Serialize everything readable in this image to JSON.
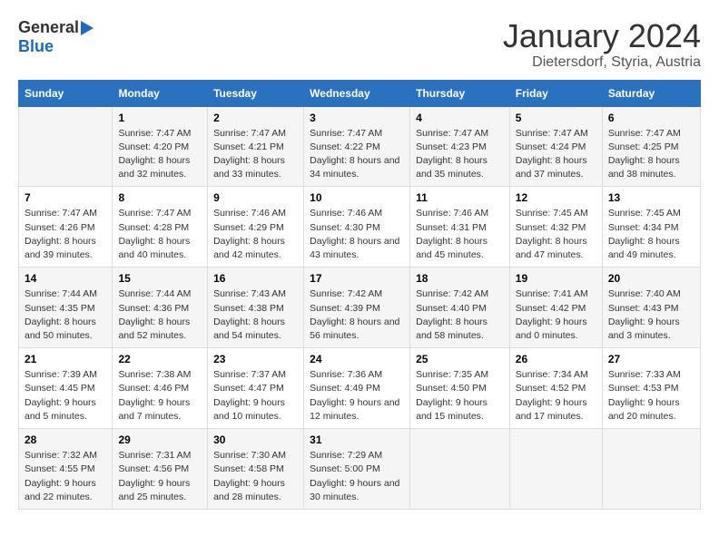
{
  "header": {
    "logo_general": "General",
    "logo_blue": "Blue",
    "month_year": "January 2024",
    "location": "Dietersdorf, Styria, Austria"
  },
  "days_of_week": [
    "Sunday",
    "Monday",
    "Tuesday",
    "Wednesday",
    "Thursday",
    "Friday",
    "Saturday"
  ],
  "weeks": [
    [
      {
        "day": "",
        "sunrise": "",
        "sunset": "",
        "daylight": ""
      },
      {
        "day": "1",
        "sunrise": "Sunrise: 7:47 AM",
        "sunset": "Sunset: 4:20 PM",
        "daylight": "Daylight: 8 hours and 32 minutes."
      },
      {
        "day": "2",
        "sunrise": "Sunrise: 7:47 AM",
        "sunset": "Sunset: 4:21 PM",
        "daylight": "Daylight: 8 hours and 33 minutes."
      },
      {
        "day": "3",
        "sunrise": "Sunrise: 7:47 AM",
        "sunset": "Sunset: 4:22 PM",
        "daylight": "Daylight: 8 hours and 34 minutes."
      },
      {
        "day": "4",
        "sunrise": "Sunrise: 7:47 AM",
        "sunset": "Sunset: 4:23 PM",
        "daylight": "Daylight: 8 hours and 35 minutes."
      },
      {
        "day": "5",
        "sunrise": "Sunrise: 7:47 AM",
        "sunset": "Sunset: 4:24 PM",
        "daylight": "Daylight: 8 hours and 37 minutes."
      },
      {
        "day": "6",
        "sunrise": "Sunrise: 7:47 AM",
        "sunset": "Sunset: 4:25 PM",
        "daylight": "Daylight: 8 hours and 38 minutes."
      }
    ],
    [
      {
        "day": "7",
        "sunrise": "Sunrise: 7:47 AM",
        "sunset": "Sunset: 4:26 PM",
        "daylight": "Daylight: 8 hours and 39 minutes."
      },
      {
        "day": "8",
        "sunrise": "Sunrise: 7:47 AM",
        "sunset": "Sunset: 4:28 PM",
        "daylight": "Daylight: 8 hours and 40 minutes."
      },
      {
        "day": "9",
        "sunrise": "Sunrise: 7:46 AM",
        "sunset": "Sunset: 4:29 PM",
        "daylight": "Daylight: 8 hours and 42 minutes."
      },
      {
        "day": "10",
        "sunrise": "Sunrise: 7:46 AM",
        "sunset": "Sunset: 4:30 PM",
        "daylight": "Daylight: 8 hours and 43 minutes."
      },
      {
        "day": "11",
        "sunrise": "Sunrise: 7:46 AM",
        "sunset": "Sunset: 4:31 PM",
        "daylight": "Daylight: 8 hours and 45 minutes."
      },
      {
        "day": "12",
        "sunrise": "Sunrise: 7:45 AM",
        "sunset": "Sunset: 4:32 PM",
        "daylight": "Daylight: 8 hours and 47 minutes."
      },
      {
        "day": "13",
        "sunrise": "Sunrise: 7:45 AM",
        "sunset": "Sunset: 4:34 PM",
        "daylight": "Daylight: 8 hours and 49 minutes."
      }
    ],
    [
      {
        "day": "14",
        "sunrise": "Sunrise: 7:44 AM",
        "sunset": "Sunset: 4:35 PM",
        "daylight": "Daylight: 8 hours and 50 minutes."
      },
      {
        "day": "15",
        "sunrise": "Sunrise: 7:44 AM",
        "sunset": "Sunset: 4:36 PM",
        "daylight": "Daylight: 8 hours and 52 minutes."
      },
      {
        "day": "16",
        "sunrise": "Sunrise: 7:43 AM",
        "sunset": "Sunset: 4:38 PM",
        "daylight": "Daylight: 8 hours and 54 minutes."
      },
      {
        "day": "17",
        "sunrise": "Sunrise: 7:42 AM",
        "sunset": "Sunset: 4:39 PM",
        "daylight": "Daylight: 8 hours and 56 minutes."
      },
      {
        "day": "18",
        "sunrise": "Sunrise: 7:42 AM",
        "sunset": "Sunset: 4:40 PM",
        "daylight": "Daylight: 8 hours and 58 minutes."
      },
      {
        "day": "19",
        "sunrise": "Sunrise: 7:41 AM",
        "sunset": "Sunset: 4:42 PM",
        "daylight": "Daylight: 9 hours and 0 minutes."
      },
      {
        "day": "20",
        "sunrise": "Sunrise: 7:40 AM",
        "sunset": "Sunset: 4:43 PM",
        "daylight": "Daylight: 9 hours and 3 minutes."
      }
    ],
    [
      {
        "day": "21",
        "sunrise": "Sunrise: 7:39 AM",
        "sunset": "Sunset: 4:45 PM",
        "daylight": "Daylight: 9 hours and 5 minutes."
      },
      {
        "day": "22",
        "sunrise": "Sunrise: 7:38 AM",
        "sunset": "Sunset: 4:46 PM",
        "daylight": "Daylight: 9 hours and 7 minutes."
      },
      {
        "day": "23",
        "sunrise": "Sunrise: 7:37 AM",
        "sunset": "Sunset: 4:47 PM",
        "daylight": "Daylight: 9 hours and 10 minutes."
      },
      {
        "day": "24",
        "sunrise": "Sunrise: 7:36 AM",
        "sunset": "Sunset: 4:49 PM",
        "daylight": "Daylight: 9 hours and 12 minutes."
      },
      {
        "day": "25",
        "sunrise": "Sunrise: 7:35 AM",
        "sunset": "Sunset: 4:50 PM",
        "daylight": "Daylight: 9 hours and 15 minutes."
      },
      {
        "day": "26",
        "sunrise": "Sunrise: 7:34 AM",
        "sunset": "Sunset: 4:52 PM",
        "daylight": "Daylight: 9 hours and 17 minutes."
      },
      {
        "day": "27",
        "sunrise": "Sunrise: 7:33 AM",
        "sunset": "Sunset: 4:53 PM",
        "daylight": "Daylight: 9 hours and 20 minutes."
      }
    ],
    [
      {
        "day": "28",
        "sunrise": "Sunrise: 7:32 AM",
        "sunset": "Sunset: 4:55 PM",
        "daylight": "Daylight: 9 hours and 22 minutes."
      },
      {
        "day": "29",
        "sunrise": "Sunrise: 7:31 AM",
        "sunset": "Sunset: 4:56 PM",
        "daylight": "Daylight: 9 hours and 25 minutes."
      },
      {
        "day": "30",
        "sunrise": "Sunrise: 7:30 AM",
        "sunset": "Sunset: 4:58 PM",
        "daylight": "Daylight: 9 hours and 28 minutes."
      },
      {
        "day": "31",
        "sunrise": "Sunrise: 7:29 AM",
        "sunset": "Sunset: 5:00 PM",
        "daylight": "Daylight: 9 hours and 30 minutes."
      },
      {
        "day": "",
        "sunrise": "",
        "sunset": "",
        "daylight": ""
      },
      {
        "day": "",
        "sunrise": "",
        "sunset": "",
        "daylight": ""
      },
      {
        "day": "",
        "sunrise": "",
        "sunset": "",
        "daylight": ""
      }
    ]
  ]
}
